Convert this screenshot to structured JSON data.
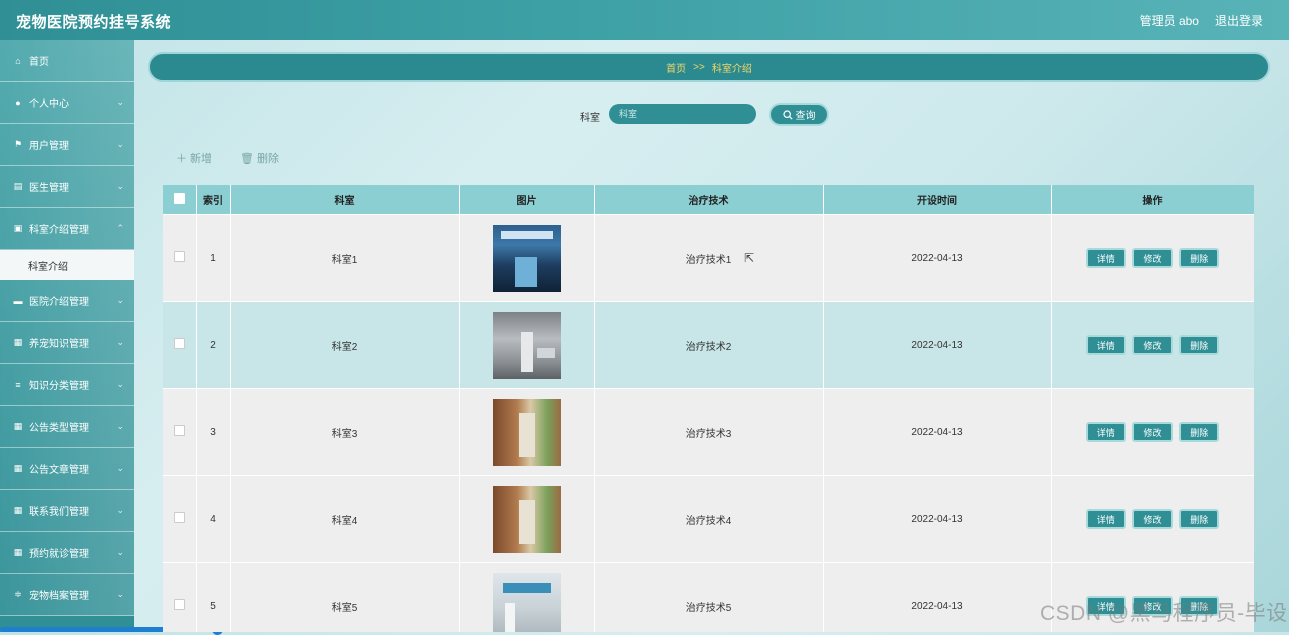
{
  "header": {
    "app_title": "宠物医院预约挂号系统",
    "user_label": "管理员 abo",
    "logout_label": "退出登录"
  },
  "sidebar": {
    "items": [
      {
        "label": "首页",
        "icon": "home-icon",
        "glyph": "⌂"
      },
      {
        "label": "个人中心",
        "icon": "user-icon",
        "glyph": "●"
      },
      {
        "label": "用户管理",
        "icon": "flag-icon",
        "glyph": "⚑"
      },
      {
        "label": "医生管理",
        "icon": "book-icon",
        "glyph": "▤"
      },
      {
        "label": "科室介绍管理",
        "icon": "clipboard-icon",
        "glyph": "▣"
      },
      {
        "label": "医院介绍管理",
        "icon": "ticket-icon",
        "glyph": "▬"
      },
      {
        "label": "养宠知识管理",
        "icon": "grid-icon",
        "glyph": "▦"
      },
      {
        "label": "知识分类管理",
        "icon": "list-icon",
        "glyph": "≡"
      },
      {
        "label": "公告类型管理",
        "icon": "grid-icon",
        "glyph": "▦"
      },
      {
        "label": "公告文章管理",
        "icon": "grid-icon",
        "glyph": "▦"
      },
      {
        "label": "联系我们管理",
        "icon": "grid-icon",
        "glyph": "▦"
      },
      {
        "label": "预约就诊管理",
        "icon": "grid-icon",
        "glyph": "▦"
      },
      {
        "label": "宠物档案管理",
        "icon": "sliders-icon",
        "glyph": "≑"
      }
    ],
    "sub_item": "科室介绍"
  },
  "breadcrumb": {
    "home": "首页",
    "sep": ">>",
    "current": "科室介绍"
  },
  "search": {
    "label": "科室",
    "placeholder": "科室",
    "button": "查询"
  },
  "actions": {
    "add": "新增",
    "delete": "删除"
  },
  "table": {
    "headers": {
      "index": "索引",
      "dept": "科室",
      "image": "图片",
      "tech": "治疗技术",
      "time": "开设时间",
      "ops": "操作"
    },
    "rows": [
      {
        "index": "1",
        "dept": "科室1",
        "tech": "治疗技术1",
        "time": "2022-04-13"
      },
      {
        "index": "2",
        "dept": "科室2",
        "tech": "治疗技术2",
        "time": "2022-04-13"
      },
      {
        "index": "3",
        "dept": "科室3",
        "tech": "治疗技术3",
        "time": "2022-04-13"
      },
      {
        "index": "4",
        "dept": "科室4",
        "tech": "治疗技术4",
        "time": "2022-04-13"
      },
      {
        "index": "5",
        "dept": "科室5",
        "tech": "治疗技术5",
        "time": "2022-04-13"
      }
    ],
    "ops": {
      "detail": "详情",
      "edit": "修改",
      "delete": "删除"
    }
  },
  "watermark": "CSDN @黑马程序员-毕设",
  "colors": {
    "primary": "#2f8f95",
    "header_bg": "#8ccfd2",
    "breadcrumb_text": "#f5d66a"
  }
}
